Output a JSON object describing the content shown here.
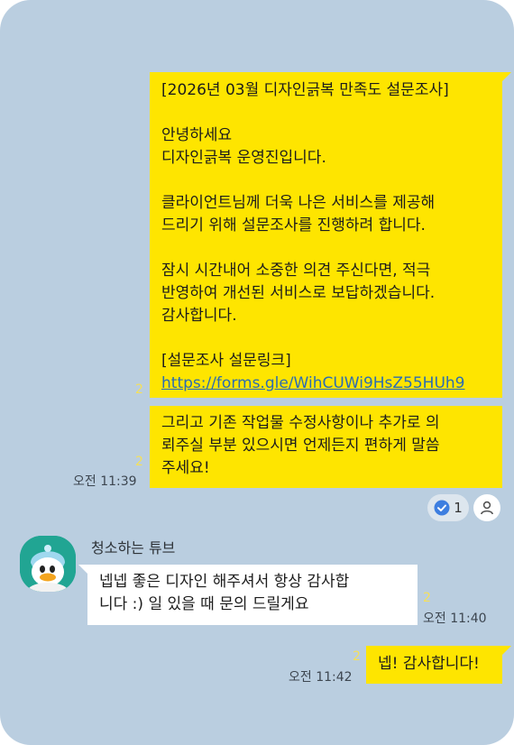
{
  "messages": {
    "survey": {
      "title": "[2026년 03월 디자인긁복 만족도 설문조사]",
      "greeting1": "안녕하세요",
      "greeting2": "디자인긁복 운영진입니다.",
      "p1_line1": "클라이언트님께 더욱 나은 서비스를 제공해",
      "p1_line2": "드리기 위해 설문조사를 진행하려 합니다.",
      "p2_line1": "잠시 시간내어 소중한 의견 주신다면, 적극",
      "p2_line2": "반영하여 개선된 서비스로 보답하겠습니다.",
      "p2_line3": "감사합니다.",
      "link_label": "[설문조사 설문링크]",
      "link_url": "https://forms.gle/WihCUWi9HsZ55HUh9",
      "unread": "2"
    },
    "followup": {
      "line1": "그리고 기존 작업물 수정사항이나 추가로 의",
      "line2": "뢰주실 부분 있으시면 언제든지 편하게 말씀",
      "line3": "주세요!",
      "unread": "2",
      "time": "오전 11:39"
    },
    "reaction": {
      "icon": "check-circle-icon",
      "count": "1"
    },
    "reply": {
      "sender": "청소하는 튜브",
      "line1": "넵넵 좋은 디자인 해주셔서 항상 감사합",
      "line2": "니다 :) 일 있을 때 문의 드릴게요",
      "unread": "2",
      "time": "오전 11:40"
    },
    "thanks": {
      "text": "넵! 감사합니다!",
      "unread": "2",
      "time": "오전 11:42"
    }
  },
  "colors": {
    "chat_background": "#bacee0",
    "my_bubble": "#fee500",
    "other_bubble": "#ffffff",
    "link": "#2b6db3",
    "reaction_check": "#3d7ee0"
  }
}
